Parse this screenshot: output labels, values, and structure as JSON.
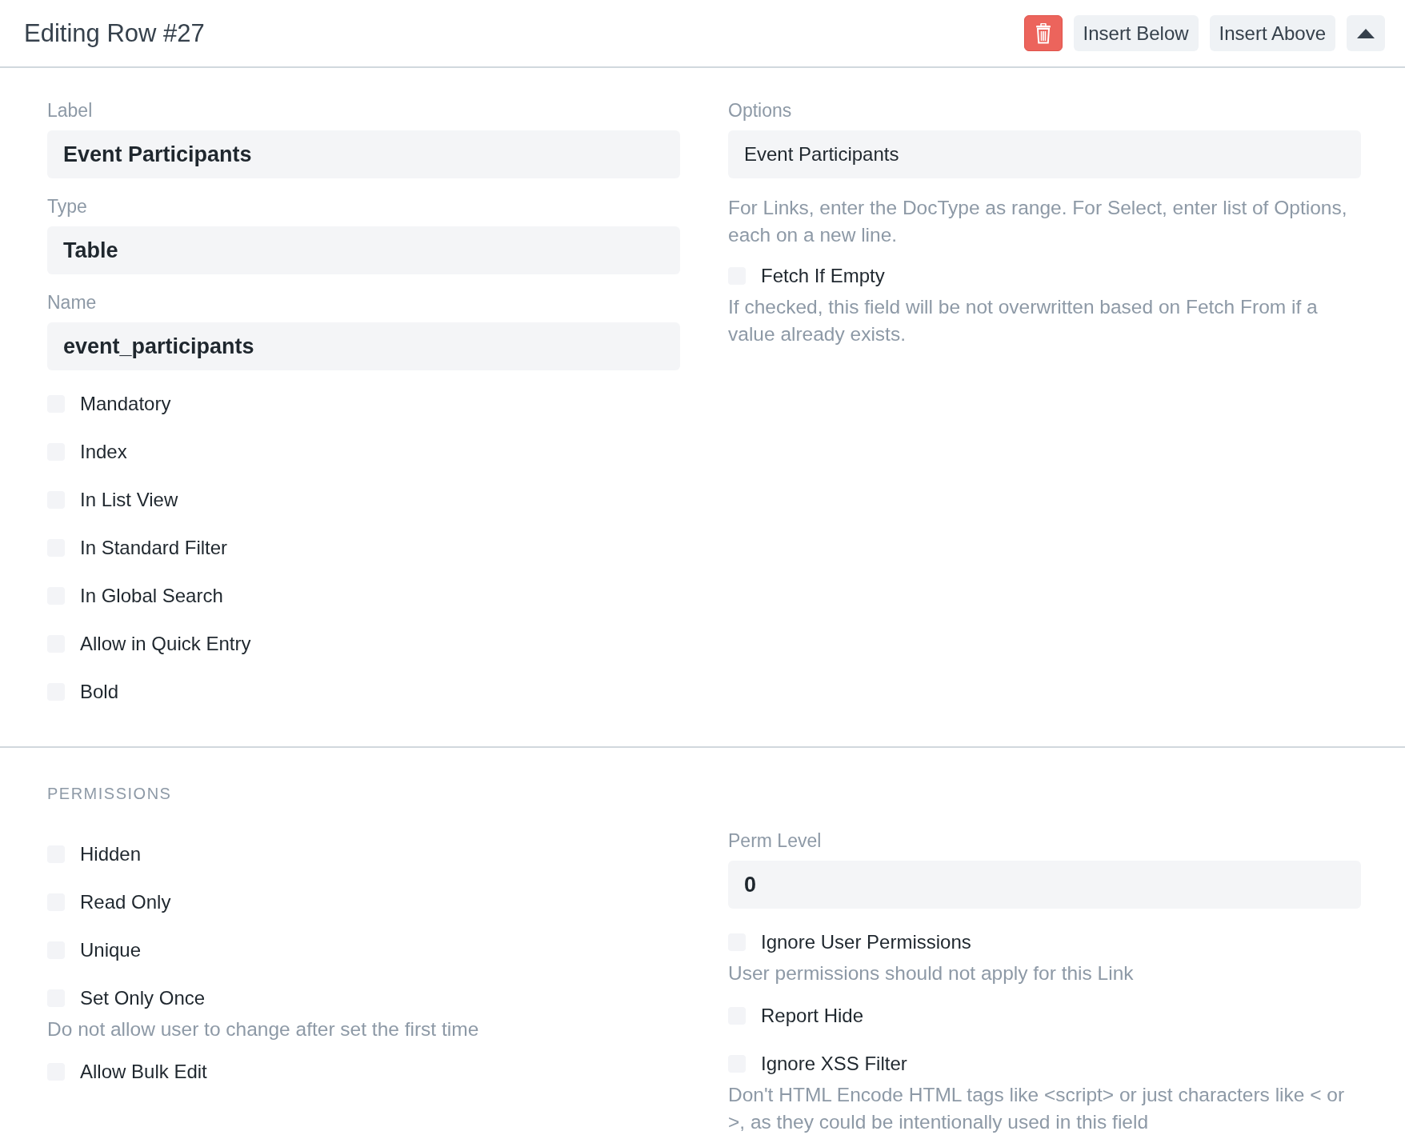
{
  "header": {
    "title": "Editing Row #27",
    "buttons": [
      {
        "kind": "delete"
      },
      {
        "kind": "text",
        "label": "Insert Below"
      },
      {
        "kind": "text",
        "label": "Insert Above"
      },
      {
        "kind": "collapse"
      }
    ]
  },
  "sections": [
    {
      "columns": [
        [
          {
            "kind": "field",
            "label": "Label",
            "value": "Event Participants",
            "bold": true
          },
          {
            "kind": "field",
            "label": "Type",
            "value": "Table",
            "bold": true
          },
          {
            "kind": "field",
            "label": "Name",
            "value": "event_participants",
            "bold": true
          },
          {
            "kind": "check",
            "label": "Mandatory",
            "checked": false
          },
          {
            "kind": "check",
            "label": "Index",
            "checked": false
          },
          {
            "kind": "check",
            "label": "In List View",
            "checked": false
          },
          {
            "kind": "check",
            "label": "In Standard Filter",
            "checked": false
          },
          {
            "kind": "check",
            "label": "In Global Search",
            "checked": false
          },
          {
            "kind": "check",
            "label": "Allow in Quick Entry",
            "checked": false
          },
          {
            "kind": "check",
            "label": "Bold",
            "checked": false
          }
        ],
        [
          {
            "kind": "field",
            "label": "Options",
            "value": "Event Participants",
            "bold": false
          },
          {
            "kind": "description",
            "text": "For Links, enter the DocType as range. For Select, enter list of Options, each on a new line."
          },
          {
            "kind": "check",
            "label": "Fetch If Empty",
            "checked": false
          },
          {
            "kind": "description",
            "text": "If checked, this field will be not overwritten based on Fetch From if a value already exists."
          }
        ]
      ]
    },
    {
      "heading": "PERMISSIONS",
      "columns": [
        [
          {
            "kind": "check",
            "label": "Hidden",
            "checked": false
          },
          {
            "kind": "check",
            "label": "Read Only",
            "checked": false
          },
          {
            "kind": "check",
            "label": "Unique",
            "checked": false
          },
          {
            "kind": "check",
            "label": "Set Only Once",
            "checked": false
          },
          {
            "kind": "description",
            "text": "Do not allow user to change after set the first time"
          },
          {
            "kind": "check",
            "label": "Allow Bulk Edit",
            "checked": false
          }
        ],
        [
          {
            "kind": "field",
            "label": "Perm Level",
            "value": "0",
            "bold": true
          },
          {
            "kind": "check",
            "label": "Ignore User Permissions",
            "checked": false
          },
          {
            "kind": "description",
            "text": "User permissions should not apply for this Link"
          },
          {
            "kind": "check",
            "label": "Report Hide",
            "checked": false
          },
          {
            "kind": "check",
            "label": "Ignore XSS Filter",
            "checked": false
          },
          {
            "kind": "description",
            "text": "Don't HTML Encode HTML tags like <script> or just characters like < or >, as they could be intentionally used in this field"
          }
        ]
      ]
    }
  ]
}
